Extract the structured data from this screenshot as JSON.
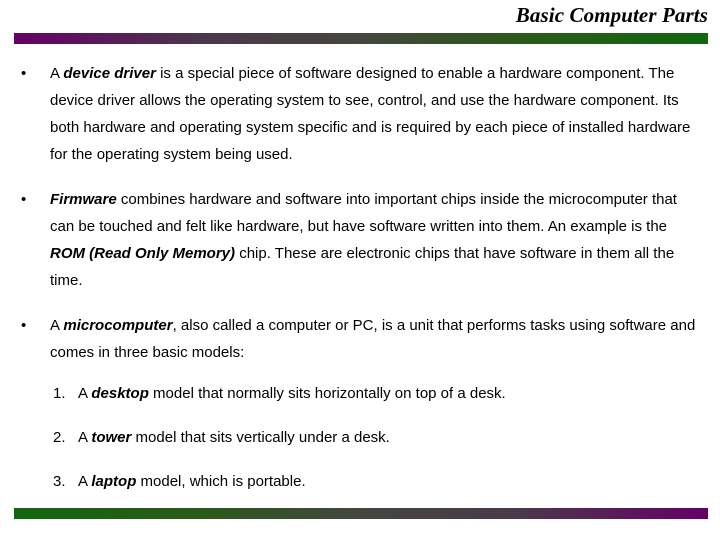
{
  "slide": {
    "title": "Basic Computer Parts",
    "colors": {
      "accent_purple": "#660066",
      "accent_green": "#116611",
      "text": "#000000",
      "background": "#ffffff"
    },
    "bullet_marker": "•",
    "bullets": [
      {
        "marker": "•",
        "segments": [
          {
            "text": "A ",
            "style": "normal"
          },
          {
            "text": "device driver",
            "style": "bold-italic"
          },
          {
            "text": " is a special  piece of software designed to enable a hardware component. The device driver allows the operating system to see, control, and use the hardware component. Its both hardware and operating system specific and is required by each piece of installed hardware for the operating system being used.",
            "style": "normal"
          }
        ]
      },
      {
        "marker": "•",
        "segments": [
          {
            "text": "Firmware",
            "style": "bold-italic"
          },
          {
            "text": " combines hardware and software into important chips inside the microcomputer that can be touched and felt like hardware, but have software written into them. An example is the ",
            "style": "normal"
          },
          {
            "text": "ROM (Read Only Memory)",
            "style": "bold-italic"
          },
          {
            "text": " chip. These are electronic chips that have software in them all the time.",
            "style": "normal"
          }
        ]
      },
      {
        "marker": "•",
        "segments": [
          {
            "text": "A ",
            "style": "normal"
          },
          {
            "text": "microcomputer",
            "style": "bold-italic"
          },
          {
            "text": ", also called a computer or PC, is a unit that performs tasks using software and comes in three basic models:",
            "style": "normal"
          }
        ]
      }
    ],
    "numbered_list": [
      {
        "number": "1.",
        "segments": [
          {
            "text": "A ",
            "style": "normal"
          },
          {
            "text": "desktop",
            "style": "bold-italic"
          },
          {
            "text": " model that normally sits horizontally on top of a desk.",
            "style": "normal"
          }
        ]
      },
      {
        "number": "2.",
        "segments": [
          {
            "text": "A ",
            "style": "normal"
          },
          {
            "text": "tower",
            "style": "bold-italic"
          },
          {
            "text": " model that sits vertically under a desk.",
            "style": "normal"
          }
        ]
      },
      {
        "number": "3.",
        "segments": [
          {
            "text": "A ",
            "style": "normal"
          },
          {
            "text": "laptop",
            "style": "bold-italic"
          },
          {
            "text": " model, which is portable.",
            "style": "normal"
          }
        ]
      }
    ]
  }
}
